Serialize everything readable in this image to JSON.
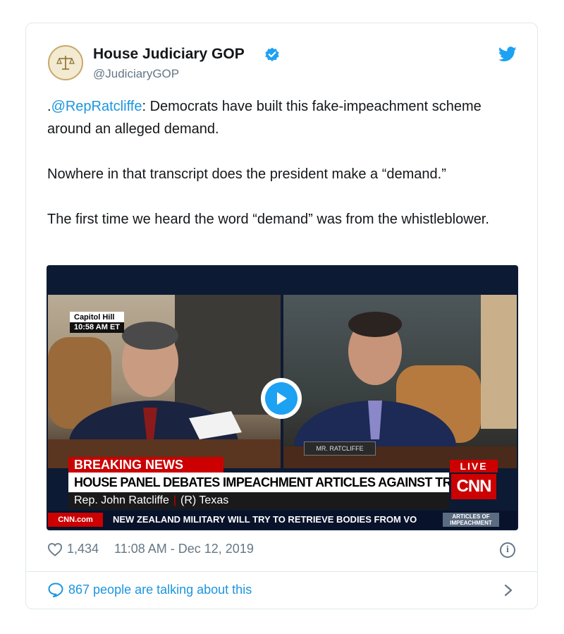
{
  "tweet": {
    "author_name": "House Judiciary GOP",
    "author_handle": "@JudiciaryGOP",
    "text_mention": "@RepRatcliffe",
    "text_lead": ".",
    "text_line1_rest": ": Democrats have built this fake-impeachment scheme around an alleged demand.",
    "text_para2": "Nowhere in that transcript does the president make a “demand.”",
    "text_para3": "The first time we heard the word “demand” was from the whistleblower.",
    "likes": "1,434",
    "timestamp": "11:08 AM - Dec 12, 2019",
    "talking": "867 people are talking about this"
  },
  "video": {
    "location": "Capitol Hill",
    "time": "10:58 AM ET",
    "nameplate": "MR. RATCLIFFE",
    "breaking": "BREAKING NEWS",
    "headline": "HOUSE PANEL DEBATES IMPEACHMENT ARTICLES AGAINST TRUMP BEFORE VOTE",
    "speaker": "Rep. John Ratcliffe",
    "speaker_party": "(R) Texas",
    "live": "LIVE",
    "network": "CNN",
    "site": "CNN.com",
    "ticker": "NEW ZEALAND MILITARY WILL TRY TO RETRIEVE BODIES FROM VO",
    "articles": "ARTICLES OF IMPEACHMENT"
  },
  "icons": {
    "verified": "verified-badge-icon",
    "bird": "twitter-bird-icon",
    "heart": "heart-icon",
    "info": "info-icon",
    "bubble": "speech-bubble-icon",
    "chevron": "chevron-right-icon",
    "play": "play-icon"
  },
  "colors": {
    "link": "#1b95e0",
    "twitter_blue": "#1da1f2",
    "meta_gray": "#657786",
    "cnn_red": "#cc0000"
  }
}
